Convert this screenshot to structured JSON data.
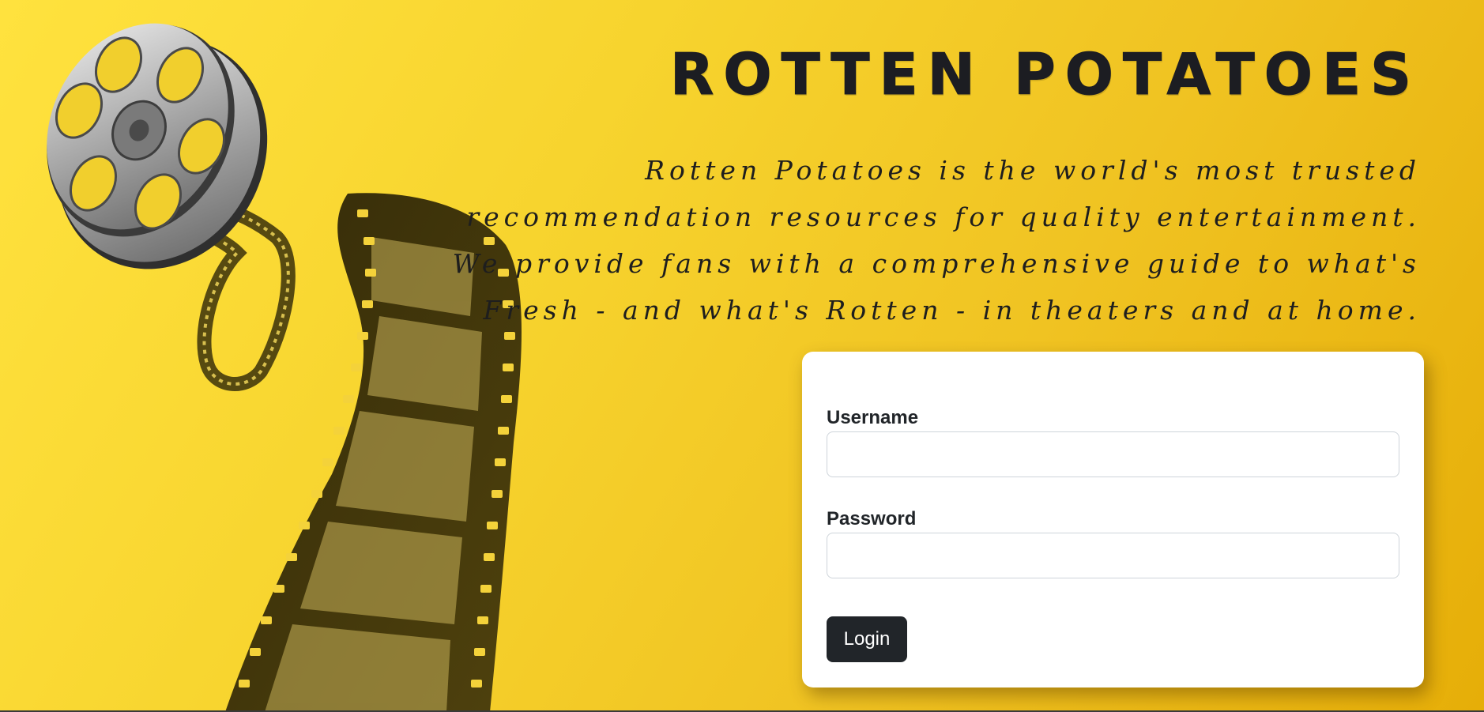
{
  "header": {
    "title": "Rotten Potatoes",
    "tagline": "Rotten Potatoes is the world's most trusted recommendation resources for quality entertainment. We provide fans with a comprehensive guide to what's Fresh - and what's Rotten - in theaters and at home."
  },
  "login": {
    "username_label": "Username",
    "username_value": "",
    "password_label": "Password",
    "password_value": "",
    "button_label": "Login"
  },
  "decor": {
    "illustration": "film-reel-icon"
  },
  "colors": {
    "background_start": "#ffe23e",
    "background_end": "#e6ae08",
    "title_color": "#1c1d22",
    "button_bg": "#212529",
    "card_bg": "#ffffff"
  }
}
